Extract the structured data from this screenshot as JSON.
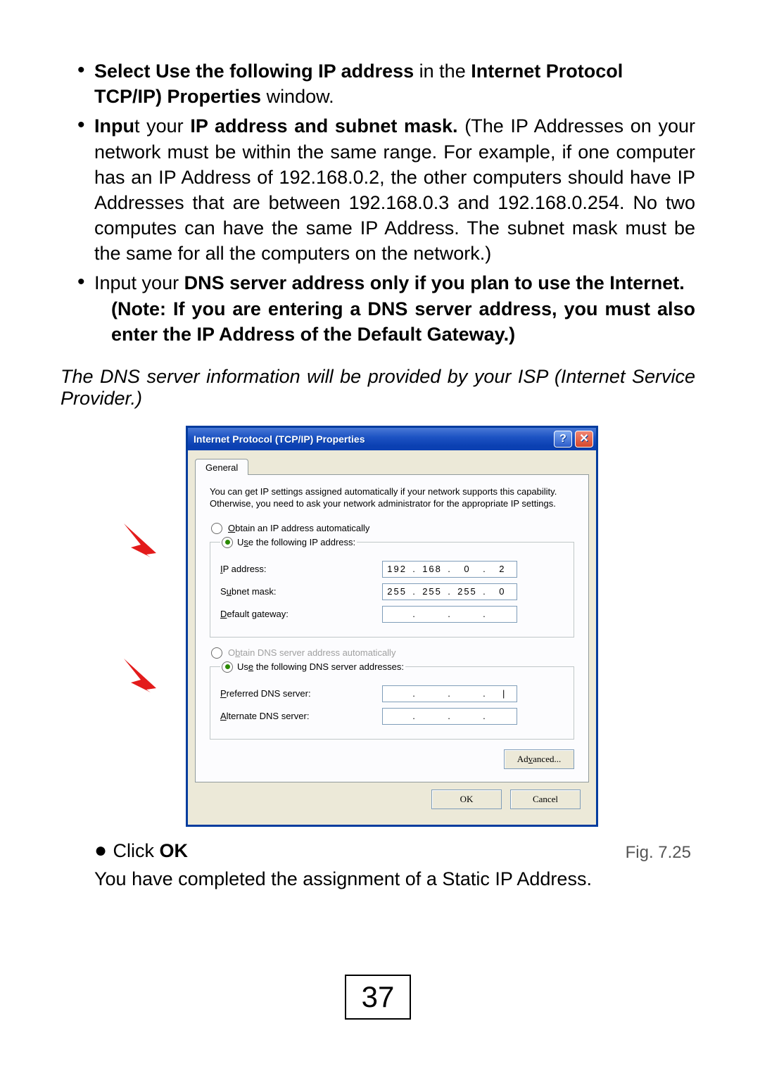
{
  "instructions": {
    "b1_lead": "Select ",
    "b1_bold1": "Use the following IP address",
    "b1_mid": " in the ",
    "b1_bold2": "Internet Protocol TCP/IP) Properties",
    "b1_tail": " window.",
    "b2_lead": "Inpu",
    "b2_t": "t your ",
    "b2_bold": "IP address and subnet mask.",
    "b2_rest": " (The IP Addresses on your network must be within the same range. For example, if one computer has an IP Address of 192.168.0.2, the other computers should have IP Addresses that are between 192.168.0.3 and 192.168.0.254.  No two computes can have the same IP Address.  The subnet mask must be the same for all the computers on the network.)",
    "b3_lead": "Input your ",
    "b3_bold": "DNS server address only if you plan to use the Internet.",
    "b3_note": "(Note:  If you are entering a DNS server address, you must also enter the IP Address of the Default Gateway.)"
  },
  "isp_note": "The DNS server information will be provided by your ISP (Internet Service Provider.)",
  "dialog": {
    "title": "Internet Protocol (TCP/IP) Properties",
    "tab": "General",
    "explain": "You can get IP settings assigned automatically if your network supports this capability. Otherwise, you need to ask your network administrator for the appropriate IP settings.",
    "radio_auto_ip": "Obtain an IP address automatically",
    "radio_static_ip": "Use the following IP address:",
    "label_ip": "IP address:",
    "label_subnet": "Subnet mask:",
    "label_gateway": "Default gateway:",
    "radio_auto_dns": "Obtain DNS server address automatically",
    "radio_static_dns": "Use the following DNS server addresses:",
    "label_pref_dns": "Preferred DNS server:",
    "label_alt_dns": "Alternate DNS server:",
    "ip_value": [
      "192",
      "168",
      "0",
      "2"
    ],
    "subnet_value": [
      "255",
      "255",
      "255",
      "0"
    ],
    "advanced": "Advanced...",
    "ok": "OK",
    "cancel": "Cancel"
  },
  "fig_label": "Fig. 7.25",
  "click_ok_lead": "Click ",
  "click_ok_bold": "OK",
  "completed": "You have completed the assignment of a Static IP Address.",
  "page_number": "37"
}
